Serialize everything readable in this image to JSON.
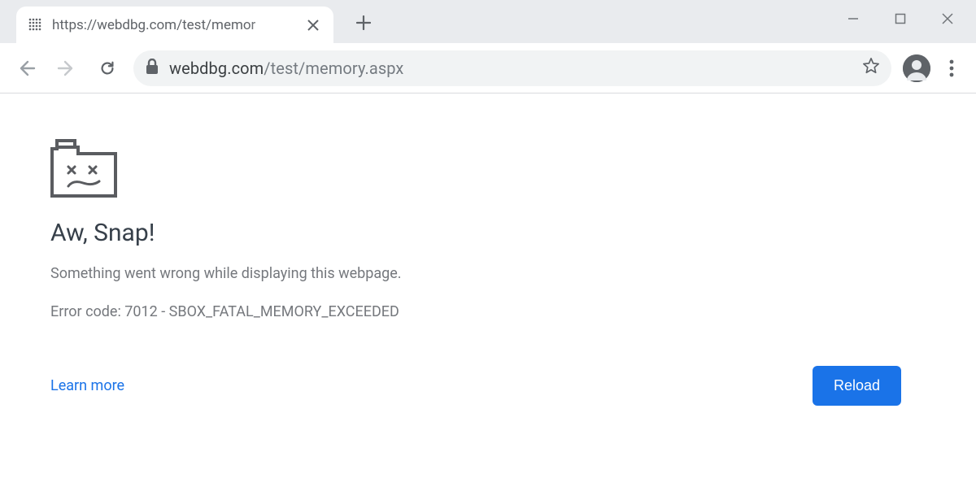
{
  "tab": {
    "title": "https://webdbg.com/test/memor"
  },
  "omnibox": {
    "host": "webdbg.com",
    "path": "/test/memory.aspx"
  },
  "error": {
    "title": "Aw, Snap!",
    "subtitle": "Something went wrong while displaying this webpage.",
    "code": "Error code: 7012 - SBOX_FATAL_MEMORY_EXCEEDED",
    "learn_more": "Learn more",
    "reload": "Reload"
  }
}
